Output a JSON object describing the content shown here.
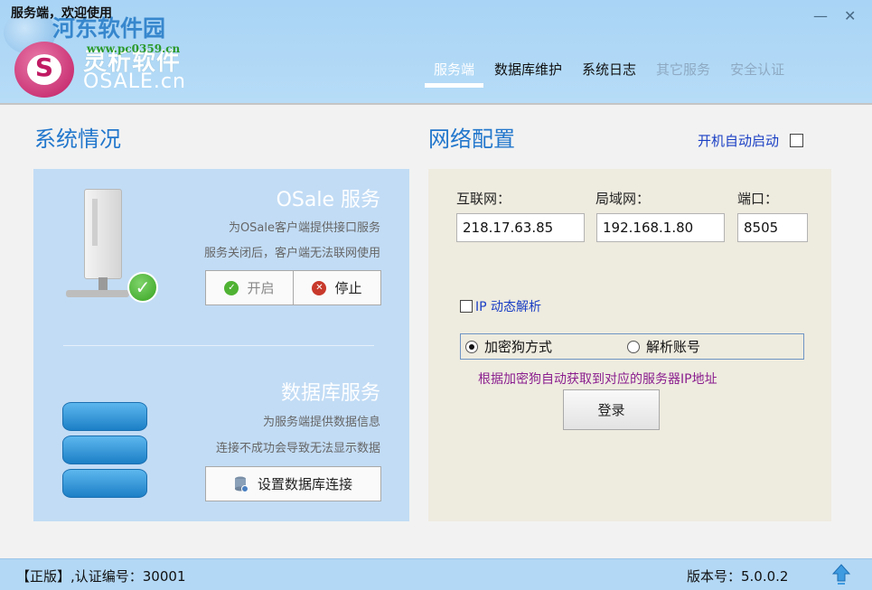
{
  "window": {
    "title": "服务端，欢迎使用",
    "watermark_text": "河东软件园",
    "watermark_url": "www.pc0359.cn",
    "logo_cn": "灵析软件",
    "logo_en": "OSALE.cn",
    "minimize": "—",
    "close": "✕"
  },
  "nav": {
    "tabs": [
      {
        "label": "服务端",
        "state": "active"
      },
      {
        "label": "数据库维护",
        "state": "normal"
      },
      {
        "label": "系统日志",
        "state": "normal"
      },
      {
        "label": "其它服务",
        "state": "disabled"
      },
      {
        "label": "安全认证",
        "state": "disabled"
      }
    ]
  },
  "system": {
    "title": "系统情况",
    "osale": {
      "title": "OSale 服务",
      "desc1": "为OSale客户端提供接口服务",
      "desc2": "服务关闭后，客户端无法联网使用",
      "start_label": "开启",
      "stop_label": "停止"
    },
    "database": {
      "title": "数据库服务",
      "desc1": "为服务端提供数据信息",
      "desc2": "连接不成功会导致无法显示数据",
      "button_label": "设置数据库连接"
    }
  },
  "network": {
    "title": "网络配置",
    "autostart_label": "开机自动启动",
    "autostart_checked": false,
    "internet_label": "互联网：",
    "internet_value": "218.17.63.85",
    "lan_label": "局域网：",
    "lan_value": "192.168.1.80",
    "port_label": "端口：",
    "port_value": "8505",
    "ip_dynamic_label": "IP 动态解析",
    "ip_dynamic_checked": false,
    "radio_dongle": "加密狗方式",
    "radio_account": "解析账号",
    "radio_selected": "dongle",
    "hint": "根据加密狗自动获取到对应的服务器IP地址",
    "login_label": "登录"
  },
  "status": {
    "left": "【正版】,认证编号：30001",
    "right": "版本号：5.0.0.2"
  },
  "colors": {
    "header": "#b0d8f6",
    "accent": "#2277cc",
    "left_panel": "#c2dcf5",
    "right_panel": "#eeebdf",
    "hint": "#8b1f8f"
  }
}
